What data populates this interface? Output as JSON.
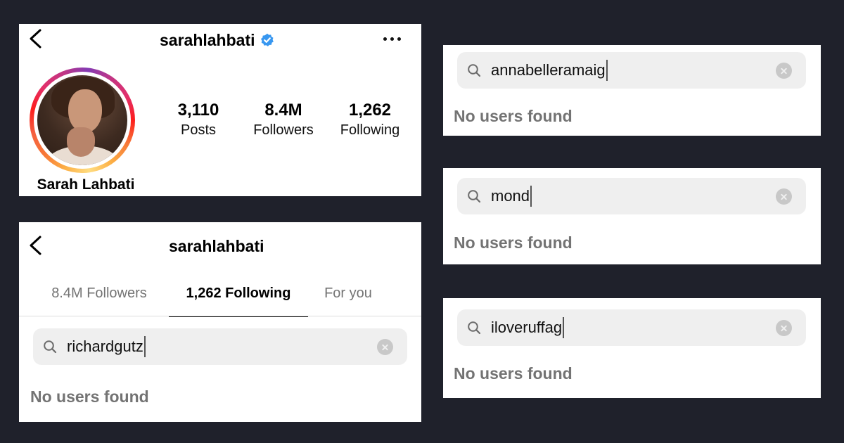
{
  "profile": {
    "username": "sarahlahbati",
    "display_name": "Sarah Lahbati",
    "stats": [
      {
        "value": "3,110",
        "label": "Posts"
      },
      {
        "value": "8.4M",
        "label": "Followers"
      },
      {
        "value": "1,262",
        "label": "Following"
      }
    ],
    "icons": {
      "back": "chevron-left-icon",
      "verified": "verified-badge-icon",
      "more": "more-options-icon"
    },
    "colors": {
      "verified": "#3897f0"
    }
  },
  "following_screen": {
    "username": "sarahlahbati",
    "tabs": [
      {
        "label": "8.4M Followers",
        "active": false
      },
      {
        "label": "1,262 Following",
        "active": true
      },
      {
        "label": "For you",
        "active": false
      }
    ],
    "search_value": "richardgutz",
    "empty_text": "No users found"
  },
  "searches": [
    {
      "search_value": "annabelleramaig",
      "empty_text": "No users found"
    },
    {
      "search_value": "mond",
      "empty_text": "No users found"
    },
    {
      "search_value": "iloveruffag",
      "empty_text": "No users found"
    }
  ]
}
